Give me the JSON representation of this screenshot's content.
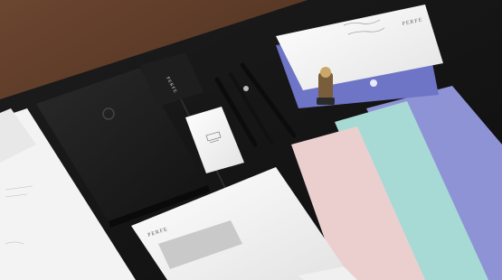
{
  "scene": {
    "brand_mark": "PERFE",
    "colors": {
      "wood": "#5a3a26",
      "desk": "#141414",
      "notebook": "#1c1c1c",
      "paper_white": "#f4f4f4",
      "envelope_purple": "#6d73c4",
      "paper_mint": "#a6d8d4",
      "paper_blush": "#e8cccc",
      "paper_periwinkle": "#8f93d8"
    },
    "icons": [
      "pen-icon",
      "notebook-icon",
      "envelope-icon",
      "fountain-pen-icon"
    ]
  }
}
